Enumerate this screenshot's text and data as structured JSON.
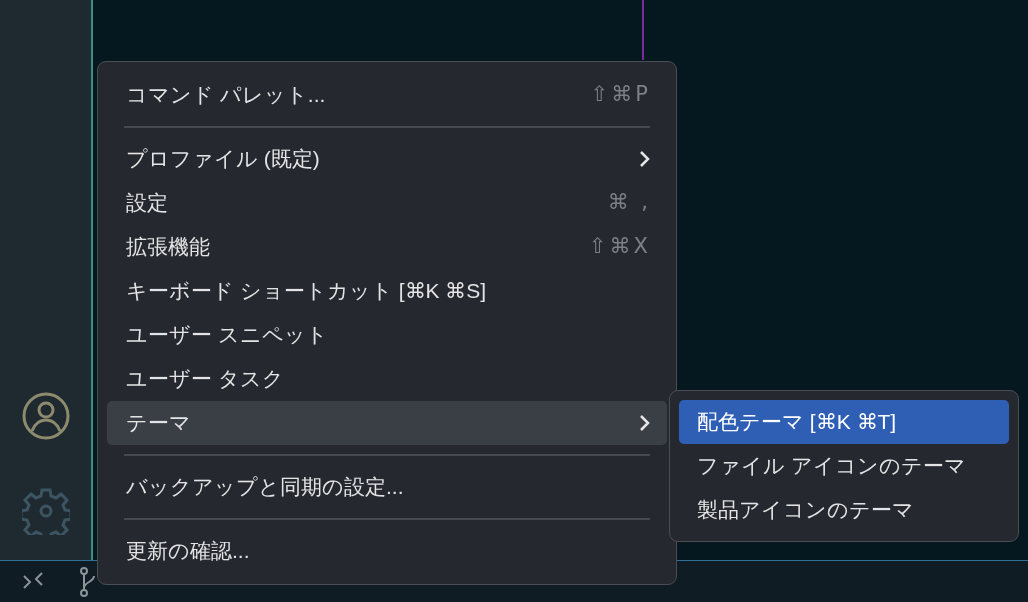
{
  "menu": {
    "items": [
      {
        "kind": "item",
        "label": "コマンド パレット...",
        "shortcut": "⇧⌘P",
        "submenu": false,
        "selected": false
      },
      {
        "kind": "separator"
      },
      {
        "kind": "item",
        "label": "プロファイル (既定)",
        "submenu": true,
        "selected": false
      },
      {
        "kind": "item",
        "label": "設定",
        "shortcut": "⌘ ,",
        "submenu": false,
        "selected": false
      },
      {
        "kind": "item",
        "label": "拡張機能",
        "shortcut": "⇧⌘X",
        "submenu": false,
        "selected": false
      },
      {
        "kind": "item",
        "label": "キーボード ショートカット [⌘K ⌘S]",
        "submenu": false,
        "selected": false
      },
      {
        "kind": "item",
        "label": "ユーザー スニペット",
        "submenu": false,
        "selected": false
      },
      {
        "kind": "item",
        "label": "ユーザー タスク",
        "submenu": false,
        "selected": false
      },
      {
        "kind": "item",
        "label": "テーマ",
        "submenu": true,
        "selected": true
      },
      {
        "kind": "separator"
      },
      {
        "kind": "item",
        "label": "バックアップと同期の設定...",
        "submenu": false,
        "selected": false
      },
      {
        "kind": "separator"
      },
      {
        "kind": "item",
        "label": "更新の確認...",
        "submenu": false,
        "selected": false
      }
    ]
  },
  "submenu": {
    "items": [
      {
        "label": "配色テーマ [⌘K ⌘T]",
        "selected": true
      },
      {
        "label": "ファイル アイコンのテーマ",
        "selected": false
      },
      {
        "label": "製品アイコンのテーマ",
        "selected": false
      }
    ]
  }
}
